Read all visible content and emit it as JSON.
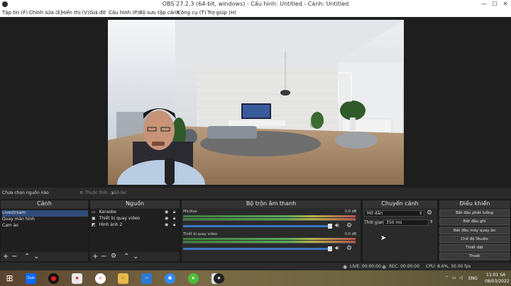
{
  "window": {
    "title": "OBS 27.2.3 (64-bit, windows) - Cấu hình: Untitled - Cảnh: Untitled",
    "controls": [
      "—",
      "☐",
      "✕"
    ]
  },
  "menu": [
    "Tập tin (F)",
    "Chỉnh sửa (E)",
    "Hiển thị (V)",
    "Giá đỡ",
    "Cấu hình (P)",
    "Bộ sưu tập cảnh",
    "Công cụ (T)",
    "Trợ giúp (H)"
  ],
  "context_bar": {
    "no_source": "Chưa chọn nguồn nào",
    "properties": "Thuộc tính",
    "filters": "Bộ lọc"
  },
  "scenes": {
    "title": "Cảnh",
    "items": [
      "Livestream",
      "Quay màn hình",
      "Cam ảo"
    ],
    "selected": "Livestream"
  },
  "sources": {
    "title": "Nguồn",
    "items": [
      {
        "label": "Karaoke",
        "icon": "display-icon"
      },
      {
        "label": "Thiết bị quay video",
        "icon": "camera-icon"
      },
      {
        "label": "Hình ảnh 2",
        "icon": "image-icon"
      }
    ]
  },
  "mixer": {
    "title": "Bộ trộn âm thanh",
    "tracks": [
      {
        "name": "Mic/Aux",
        "db": "0.0 dB",
        "volume_fraction": 1.0
      },
      {
        "name": "Thiết bị quay video",
        "db": "0.0 dB",
        "volume_fraction": 1.0
      }
    ]
  },
  "transitions": {
    "title": "Chuyển cảnh",
    "type": "Mờ dần",
    "duration_label": "Thời gian",
    "duration_value": "350 ms"
  },
  "controls": {
    "title": "Điều khiển",
    "buttons": [
      "Bắt đầu phát luồng",
      "Bắt đầu ghi",
      "Bắt đầu máy quay ảo",
      "Chế độ Studio",
      "Thiết đặt",
      "Thoát"
    ]
  },
  "status": {
    "live": "LIVE: 00:00:00",
    "rec": "REC: 00:00:00",
    "cpu": "CPU: 8.6%, 30.00 fps"
  },
  "taskbar": {
    "apps": [
      "windows-start-icon",
      "zalo-icon",
      "record-icon",
      "app-red-icon",
      "chrome-icon",
      "file-explorer-icon",
      "monitor-icon",
      "zoom-icon",
      "app-green-icon",
      "photos-icon",
      "obs-icon"
    ],
    "zalo_label": "Zalo",
    "language": "ENG",
    "time": "11:01 SA",
    "date": "08/03/2022"
  }
}
